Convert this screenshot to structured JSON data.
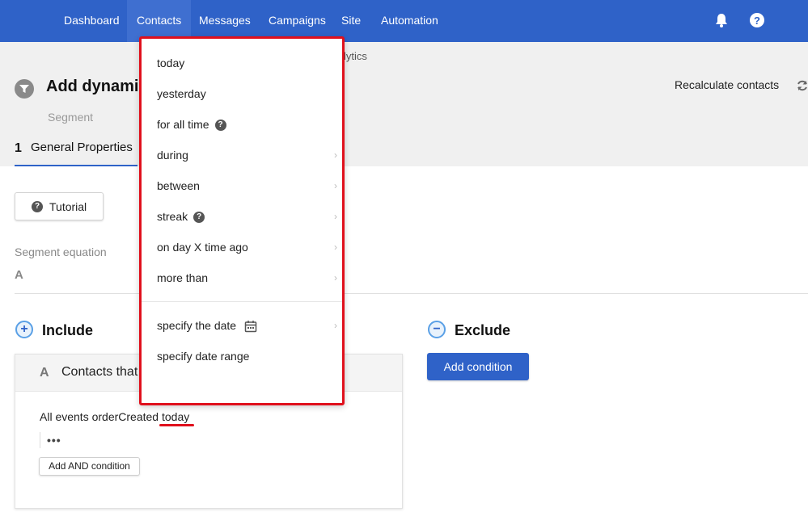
{
  "nav": {
    "items": [
      "Dashboard",
      "Contacts",
      "Messages",
      "Campaigns",
      "Site",
      "Automation"
    ],
    "active": "Contacts",
    "icons": [
      "bell-icon",
      "help-icon"
    ]
  },
  "header": {
    "breadcrumb_tail": "lytics",
    "title": "Add dynami",
    "subtitle": "Segment",
    "recalculate_label": "Recalculate contacts",
    "step_number": "1",
    "step_label": "General Properties"
  },
  "main": {
    "tutorial_label": "Tutorial",
    "equation_label": "Segment equation",
    "equation_value": "A",
    "include": {
      "title": "Include",
      "card": {
        "letter": "A",
        "title": "Contacts that",
        "condition_text": "All events orderCreated",
        "condition_date": "today",
        "more": "•••",
        "add_and_label": "Add AND condition"
      }
    },
    "exclude": {
      "title": "Exclude",
      "add_condition_label": "Add condition"
    }
  },
  "dropdown": {
    "items": [
      {
        "label": "today",
        "submenu": false,
        "help": false
      },
      {
        "label": "yesterday",
        "submenu": false,
        "help": false
      },
      {
        "label": "for all time",
        "submenu": false,
        "help": true
      },
      {
        "label": "during",
        "submenu": true,
        "help": false
      },
      {
        "label": "between",
        "submenu": true,
        "help": false
      },
      {
        "label": "streak",
        "submenu": true,
        "help": true
      },
      {
        "label": "on day X time ago",
        "submenu": true,
        "help": false
      },
      {
        "label": "more than",
        "submenu": true,
        "help": false
      }
    ],
    "extra_items": [
      {
        "label": "specify the date",
        "submenu": true,
        "icon": "calendar-icon"
      },
      {
        "label": "specify date range",
        "submenu": false
      }
    ]
  },
  "colors": {
    "nav_bg": "#2f62c8",
    "highlight_red": "#e0101c",
    "header_bg": "#f0f0f0"
  }
}
